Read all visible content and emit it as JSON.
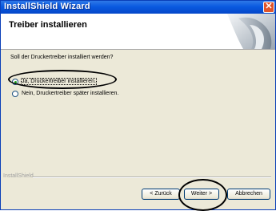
{
  "window": {
    "title": "InstallShield Wizard",
    "close_glyph": "✕"
  },
  "header": {
    "title": "Treiber installieren"
  },
  "main": {
    "question": "Soll der Druckertreiber installiert werden?",
    "options": [
      {
        "label": "Ja, Druckertreiber installieren.",
        "selected": true
      },
      {
        "label": "Nein, Druckertreiber später installieren.",
        "selected": false
      }
    ]
  },
  "brand": "InstallShield",
  "buttons": {
    "back": "< Zurück",
    "next": "Weiter >",
    "cancel": "Abbrechen"
  },
  "colors": {
    "titlebar": "#0a5ae0",
    "radio_selected": "#1ea21e",
    "close": "#e0552b"
  }
}
